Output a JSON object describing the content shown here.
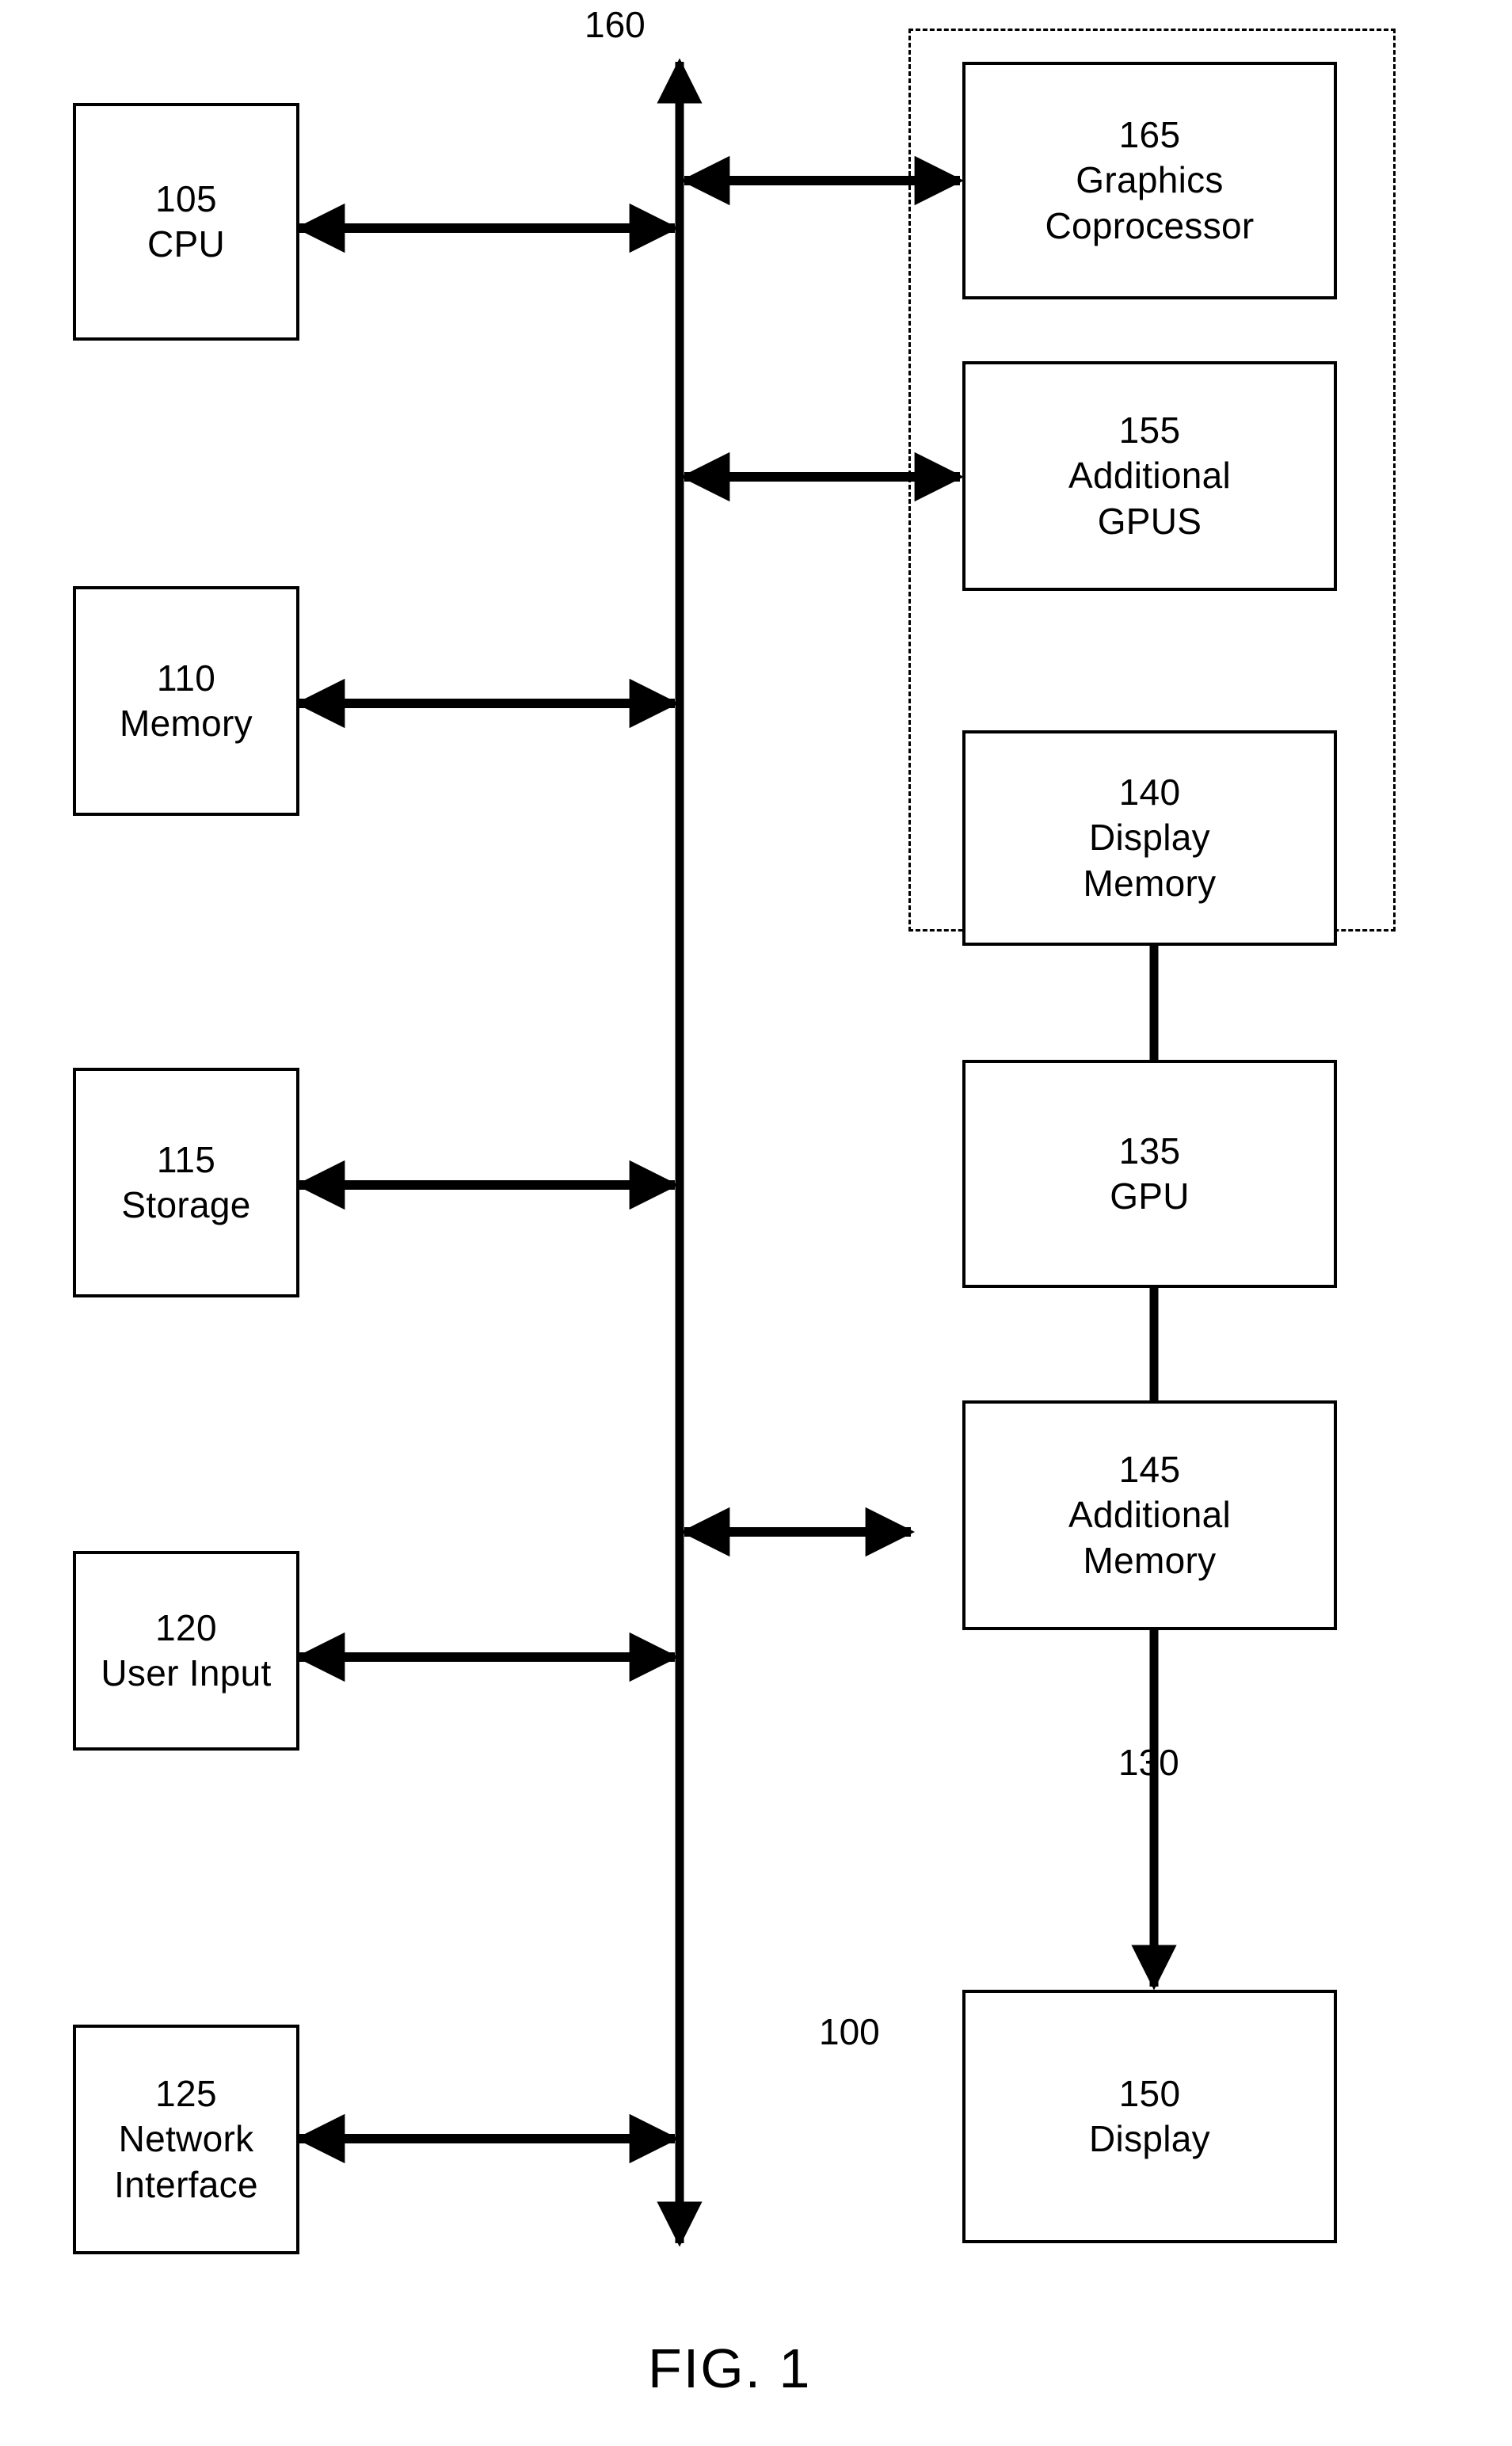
{
  "figure": {
    "caption": "FIG. 1",
    "system_ref": "100",
    "bus_ref": "160",
    "graphics_subsystem_ref": "130"
  },
  "host_blocks": [
    {
      "num": "105",
      "label": "CPU"
    },
    {
      "num": "110",
      "label": "Memory"
    },
    {
      "num": "115",
      "label": "Storage"
    },
    {
      "num": "120",
      "label": "User Input"
    },
    {
      "num": "125",
      "label": "Network\nInterface"
    }
  ],
  "graphics_blocks": [
    {
      "num": "165",
      "label": "Graphics\nCoprocessor"
    },
    {
      "num": "155",
      "label": "Additional\nGPUS"
    },
    {
      "num": "140",
      "label": "Display\nMemory"
    },
    {
      "num": "135",
      "label": "GPU"
    },
    {
      "num": "145",
      "label": "Additional\nMemory"
    }
  ],
  "output_blocks": [
    {
      "num": "150",
      "label": "Display"
    }
  ],
  "colors": {
    "stroke": "#000000",
    "background": "#ffffff"
  }
}
